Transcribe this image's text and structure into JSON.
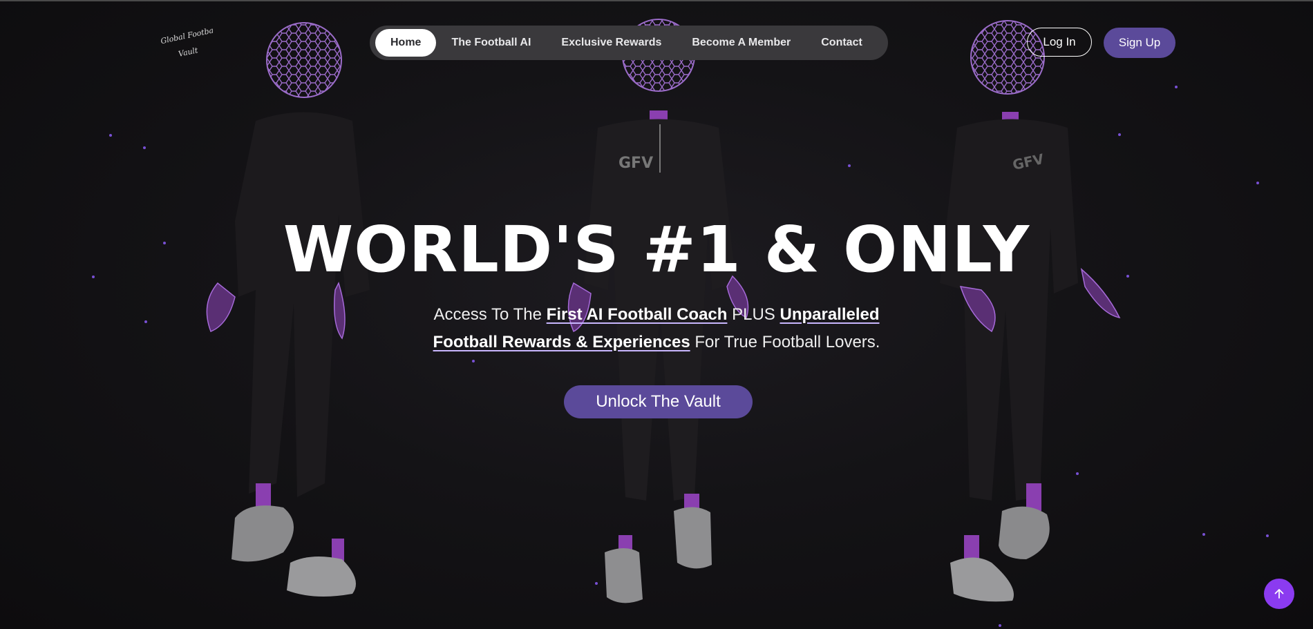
{
  "brand": {
    "logo_text_line1": "Global Football",
    "logo_text_line2": "Vault",
    "jersey_text": "GFV"
  },
  "nav": {
    "items": [
      {
        "label": "Home",
        "active": true
      },
      {
        "label": "The Football AI",
        "active": false
      },
      {
        "label": "Exclusive Rewards",
        "active": false
      },
      {
        "label": "Become A Member",
        "active": false
      },
      {
        "label": "Contact",
        "active": false
      }
    ]
  },
  "auth": {
    "login_label": "Log In",
    "signup_label": "Sign Up"
  },
  "hero": {
    "title": "WORLD'S #1 & ONLY",
    "sub_prefix": "Access To The ",
    "sub_link1": "First AI Football Coach",
    "sub_middle": " PLUS ",
    "sub_link2": "Unparalleled Football Rewards & Experiences",
    "sub_suffix": " For True Football Lovers.",
    "cta_label": "Unlock The Vault"
  },
  "icons": {
    "scroll_top": "arrow-up-icon",
    "ball": "wireframe-football-icon"
  },
  "colors": {
    "accent": "#5b4a9a",
    "scroll_button": "#8b3bf0",
    "star": "#8b5cf6",
    "background": "#111012"
  }
}
